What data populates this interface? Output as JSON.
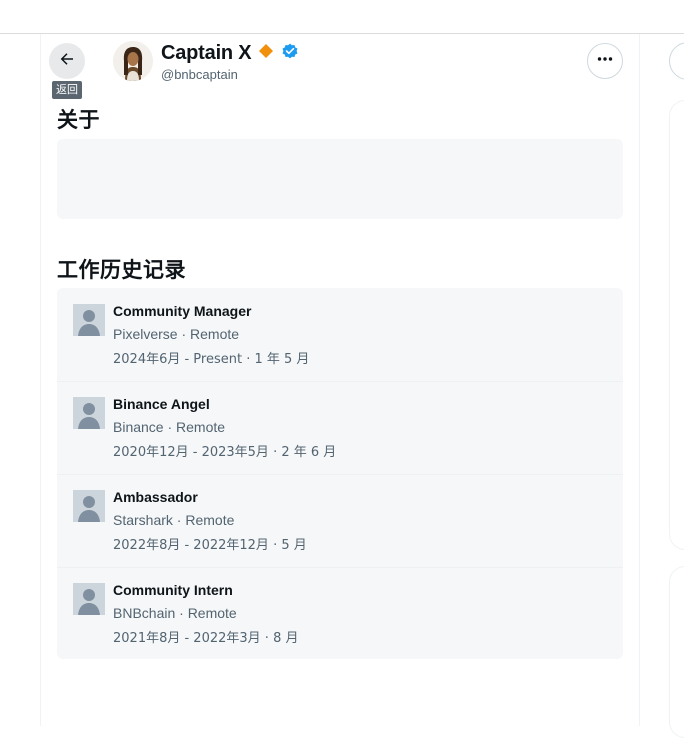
{
  "header": {
    "back_tooltip": "返回",
    "display_name": "Captain X",
    "handle": "@bnbcaptain",
    "colors": {
      "badge_diamond": "#f0900c",
      "verified": "#1d9bf0"
    }
  },
  "about": {
    "title": "关于"
  },
  "work_history": {
    "title": "工作历史记录",
    "jobs": [
      {
        "title": "Community Manager",
        "company": "Pixelverse · Remote",
        "dates": "2024年6月 - Present · 1 年 5 月"
      },
      {
        "title": "Binance Angel",
        "company": "Binance · Remote",
        "dates": "2020年12月 - 2023年5月 · 2 年 6 月"
      },
      {
        "title": "Ambassador",
        "company": "Starshark · Remote",
        "dates": "2022年8月 - 2022年12月 · 5 月"
      },
      {
        "title": "Community Intern",
        "company": "BNBchain · Remote",
        "dates": "2021年8月 - 2022年3月 · 8 月"
      }
    ]
  }
}
